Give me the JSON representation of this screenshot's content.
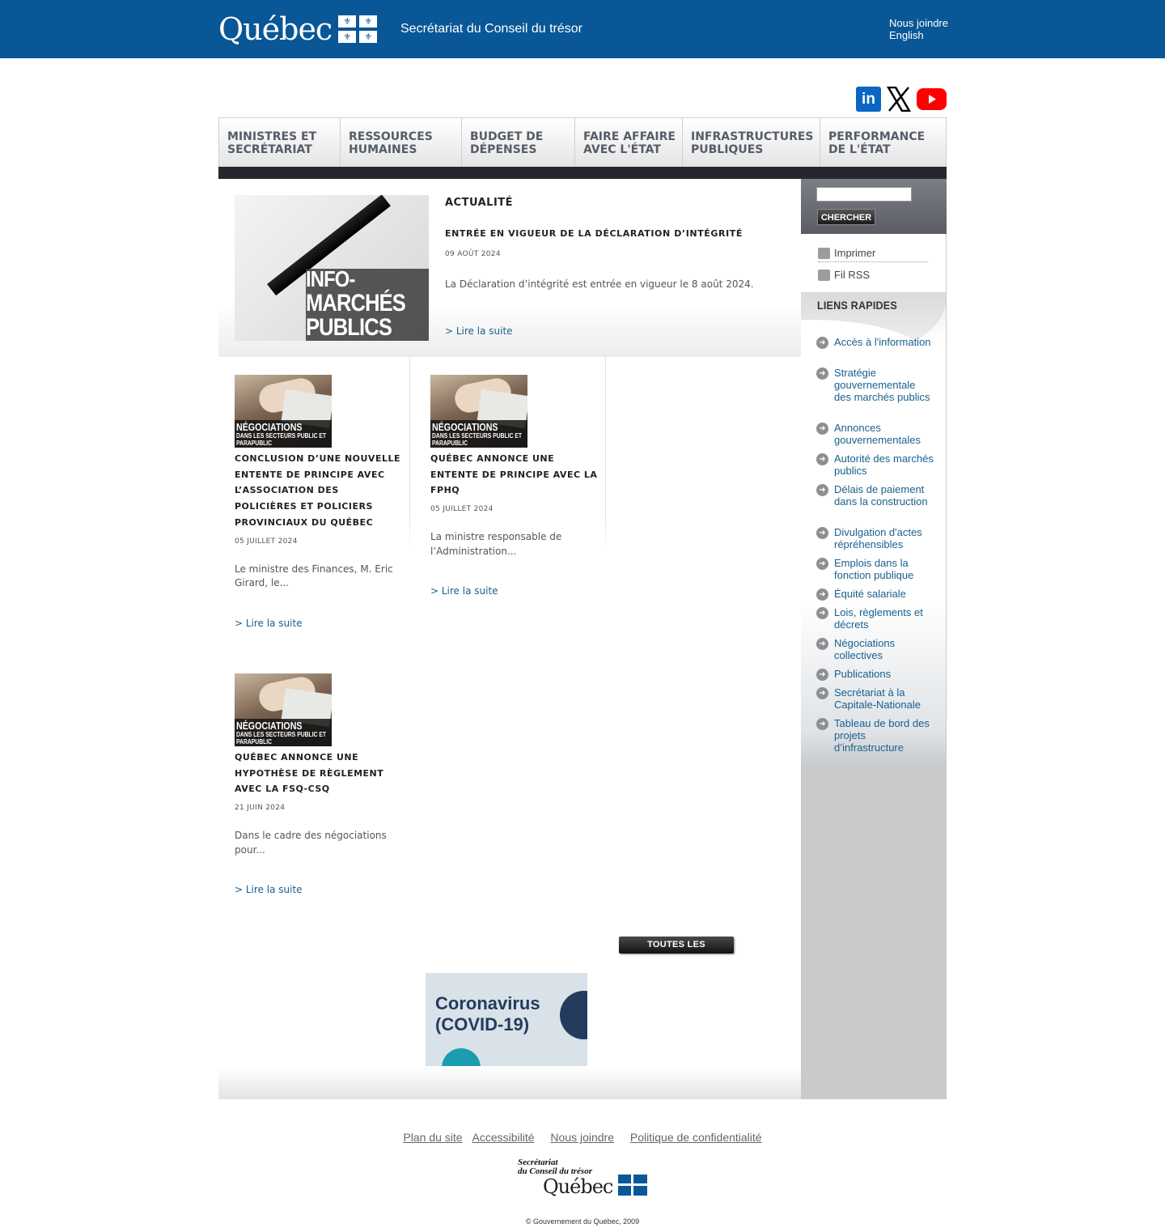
{
  "header": {
    "logo_text": "Québec",
    "organization": "Secrétariat du Conseil du trésor",
    "links": [
      "Nous joindre",
      "English"
    ]
  },
  "social": [
    "linkedin-icon",
    "x-icon",
    "youtube-icon"
  ],
  "nav": {
    "items": [
      "MINISTRES ET SECRÉTARIAT",
      "RESSOURCES HUMAINES",
      "BUDGET DE DÉPENSES",
      "FAIRE AFFAIRE AVEC L'ÉTAT",
      "INFRASTRUCTURES PUBLIQUES",
      "PERFORMANCE DE L'ÉTAT"
    ]
  },
  "feature": {
    "section_title": "ACTUALITÉ",
    "image_text": [
      "INFO-",
      "MARCHÉS",
      "PUBLICS"
    ],
    "headline": "ENTRÉE EN VIGUEUR DE LA DÉCLARATION D’INTÉGRITÉ",
    "date": "09 AOÛT 2024",
    "summary": "La Déclaration d’intégrité est entrée en vigueur le 8 août 2024.",
    "more": "> Lire la suite"
  },
  "cards_image_text": [
    "NÉGOCIATIONS",
    "DANS LES SECTEURS PUBLIC ET PARAPUBLIC"
  ],
  "news": [
    {
      "title": "CONCLUSION D’UNE NOUVELLE ENTENTE DE PRINCIPE AVEC L’ASSOCIATION DES POLICIÈRES ET POLICIERS PROVINCIAUX DU QUÉBEC",
      "date": "05 JUILLET 2024",
      "summary": "Le ministre des Finances, M. Eric Girard, le...",
      "more": "> Lire la suite"
    },
    {
      "title": "QUÉBEC ANNONCE UNE ENTENTE DE PRINCIPE AVEC LA FPHQ",
      "date": "05 JUILLET 2024",
      "summary": "La ministre responsable de l’Administration...",
      "more": "> Lire la suite"
    },
    {
      "title": "QUÉBEC ANNONCE UNE HYPOTHÈSE DE RÈGLEMENT AVEC LA FSQ-CSQ",
      "date": "21 JUIN 2024",
      "summary": "Dans le cadre des négociations pour...",
      "more": "> Lire la suite"
    }
  ],
  "all_news_button": "TOUTES LES NOUVELLES",
  "covid_banner": [
    "Coronavirus",
    "(COVID-19)"
  ],
  "sidebar": {
    "search_button": "CHERCHER",
    "search_value": "",
    "tools": [
      "Imprimer",
      "Fil RSS"
    ],
    "quick_links_title": "LIENS RAPIDES",
    "quick_links": [
      "Accès à l'information",
      "Stratégie gouvernementale des marchés publics",
      "Annonces gouvernementales",
      "Autorité des marchés publics",
      "Délais de paiement dans la construction",
      "Divulgation d'actes répréhensibles",
      "Emplois dans la fonction publique",
      "Équité salariale",
      "Lois, règlements et décrets",
      "Négociations collectives",
      "Publications",
      "Secrétariat à la Capitale-Nationale",
      "Tableau de bord des projets d’infrastructure"
    ]
  },
  "footer": {
    "links": [
      "Plan du site",
      "Accessibilité",
      "Nous joindre",
      "Politique de confidentialité"
    ],
    "logo_lines": [
      "Secrétariat",
      "du Conseil du trésor",
      "Québec"
    ],
    "copyright": "© Gouvernement du Québec, 2009"
  },
  "colors": {
    "brand_blue": "#095797",
    "link": "#1a5f8e",
    "nav_dark": "#25262e"
  }
}
